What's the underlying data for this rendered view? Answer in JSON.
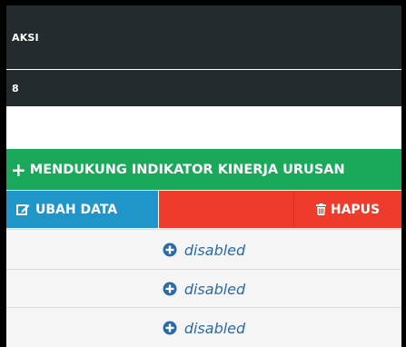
{
  "header": {
    "title": "AKSI",
    "number": "8"
  },
  "actions": {
    "support_label": "MENDUKUNG INDIKATOR KINERJA URUSAN",
    "edit_label": "UBAH DATA",
    "delete_label": "HAPUS"
  },
  "status_rows": [
    {
      "icon": "plus-circle-icon",
      "text": "disabled"
    },
    {
      "icon": "plus-circle-icon",
      "text": "disabled"
    },
    {
      "icon": "plus-circle-icon",
      "text": "disabled"
    }
  ],
  "colors": {
    "header_bg": "#232b2e",
    "green": "#1aa85a",
    "blue": "#1f95c9",
    "red": "#ef3b2c",
    "link": "#2a6aa6"
  }
}
